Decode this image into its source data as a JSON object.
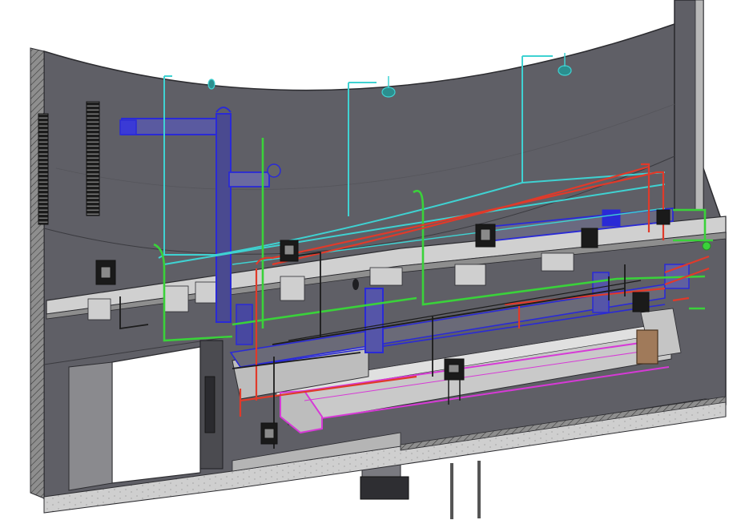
{
  "view": {
    "type": "3D BIM MEP coordination view",
    "background_color": "#ffffff",
    "wall_color": "#5f5f66",
    "wall_edge_color": "#2c2c30",
    "slab_color": "#cfcfcf"
  },
  "systems": [
    {
      "name_icon": "supply-air-duct",
      "color": "#2a2ad6"
    },
    {
      "name_icon": "return-air-duct",
      "color": "#d63ad6"
    },
    {
      "name_icon": "domestic-cold-water-pipe",
      "color": "#3fd2d2"
    },
    {
      "name_icon": "hot-water-pipe",
      "color": "#e03a2a"
    },
    {
      "name_icon": "chilled-water-pipe",
      "color": "#3ad23a"
    },
    {
      "name_icon": "drain-pipe",
      "color": "#222222"
    }
  ],
  "fixtures": [
    {
      "name_icon": "sprinkler-head-icon"
    },
    {
      "name_icon": "pipe-hanger-icon"
    },
    {
      "name_icon": "access-panel-icon"
    }
  ]
}
